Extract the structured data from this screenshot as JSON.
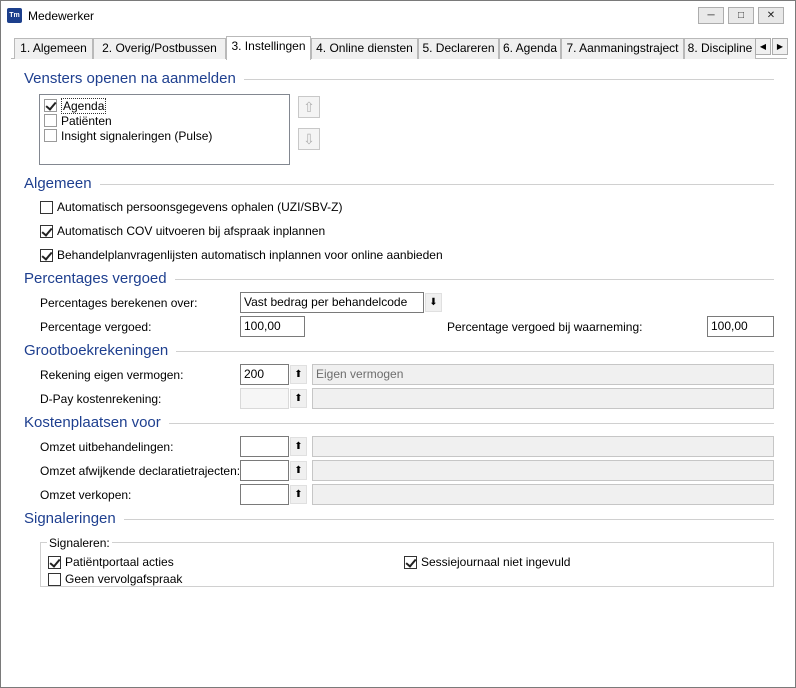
{
  "window": {
    "title": "Medewerker",
    "icon_text": "Tm",
    "minimize_icon": "minimize-icon",
    "maximize_icon": "maximize-icon",
    "close_icon": "close-icon"
  },
  "tabs": [
    {
      "label": "1. Algemeen",
      "active": false
    },
    {
      "label": "2. Overig/Postbussen",
      "active": false
    },
    {
      "label": "3. Instellingen",
      "active": true
    },
    {
      "label": "4. Online diensten",
      "active": false
    },
    {
      "label": "5. Declareren",
      "active": false
    },
    {
      "label": "6. Agenda",
      "active": false
    },
    {
      "label": "7. Aanmaningstraject",
      "active": false
    },
    {
      "label": "8. Discipline",
      "active": false
    }
  ],
  "tab_scroll": {
    "left": "◀",
    "right": "▶"
  },
  "sections": {
    "vensters": "Vensters openen na aanmelden",
    "algemeen": "Algemeen",
    "percentages": "Percentages vergoed",
    "grootboek": "Grootboekrekeningen",
    "kostenplaatsen": "Kostenplaatsen voor",
    "signaleringen": "Signaleringen"
  },
  "vensters_list": [
    {
      "label": "Agenda",
      "checked": true
    },
    {
      "label": "Patiënten",
      "checked": false
    },
    {
      "label": "Insight signaleringen (Pulse)",
      "checked": false
    }
  ],
  "move_buttons": {
    "up": "⇧",
    "down": "⇩"
  },
  "algemeen_options": [
    {
      "label": "Automatisch persoonsgegevens ophalen (UZI/SBV-Z)",
      "checked": false
    },
    {
      "label": "Automatisch COV uitvoeren bij afspraak inplannen",
      "checked": true
    },
    {
      "label": "Behandelplanvragenlijsten automatisch inplannen voor online aanbieden",
      "checked": true
    }
  ],
  "percentages": {
    "berekenen_label": "Percentages berekenen over:",
    "berekenen_value": "Vast bedrag per behandelcode",
    "vergoed_label": "Percentage vergoed:",
    "vergoed_value": "100,00",
    "waarneming_label": "Percentage vergoed bij waarneming:",
    "waarneming_value": "100,00"
  },
  "grootboek": {
    "eigen_label": "Rekening eigen vermogen:",
    "eigen_code": "200",
    "eigen_desc": "Eigen vermogen",
    "dpay_label": "D-Pay kostenrekening:",
    "dpay_code": "",
    "dpay_desc": ""
  },
  "kostenplaatsen": {
    "uitbehandelingen_label": "Omzet uitbehandelingen:",
    "afwijkende_label": "Omzet afwijkende declaratietrajecten:",
    "verkopen_label": "Omzet verkopen:"
  },
  "signaleringen": {
    "legend": "Signaleren:",
    "items": [
      {
        "label": "Patiëntportaal acties",
        "checked": true
      },
      {
        "label": "Sessiejournaal niet ingevuld",
        "checked": true
      },
      {
        "label": "Geen vervolgafspraak",
        "checked": false
      }
    ]
  },
  "lookup_icon": "⬆"
}
